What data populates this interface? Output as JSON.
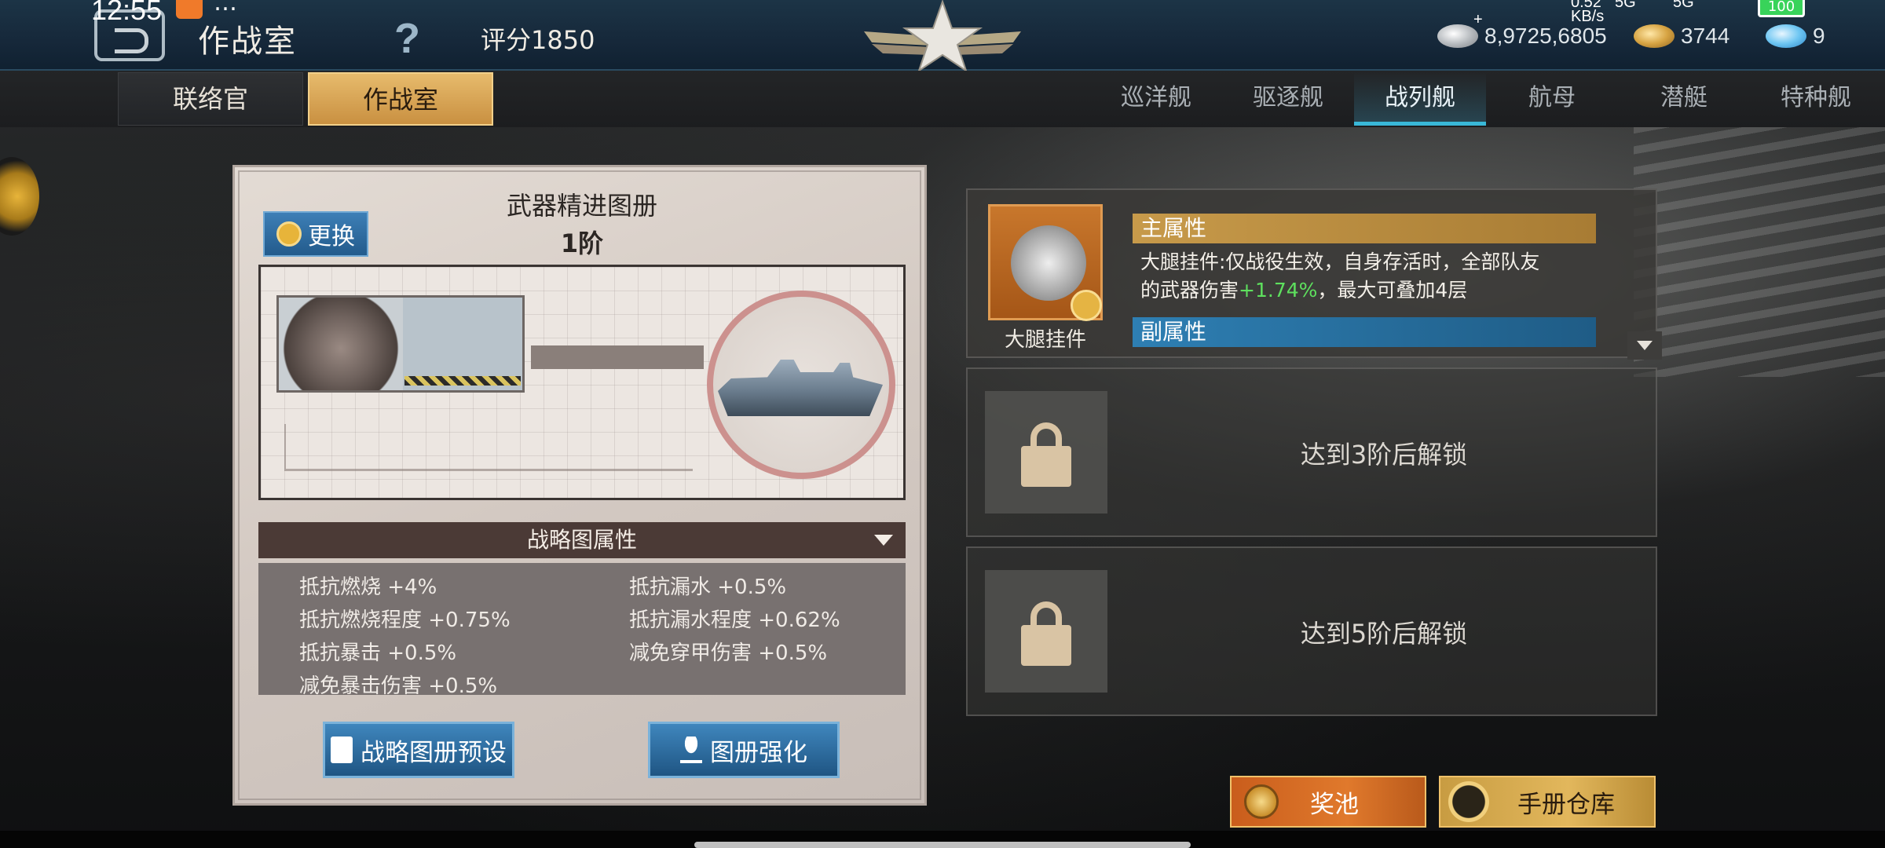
{
  "status_bar": {
    "time": "12:55",
    "more": "…",
    "net_speed_top": "0.52",
    "net_speed_unit": "KB/s",
    "signal_1": "5G",
    "signal_2": "5G",
    "battery": "100"
  },
  "header": {
    "title": "作战室",
    "help": "?",
    "score": "评分1850",
    "resources": [
      {
        "icon": "silver-coin-icon",
        "value": "8,9725,6805"
      },
      {
        "icon": "gold-coin-icon",
        "value": "3744"
      },
      {
        "icon": "cloud-gem-icon",
        "value": "9"
      }
    ],
    "silver_plus": "+"
  },
  "left_tabs": [
    {
      "label": "联络官",
      "active": false
    },
    {
      "label": "作战室",
      "active": true
    }
  ],
  "ship_tabs": [
    {
      "label": "巡洋舰",
      "active": false
    },
    {
      "label": "驱逐舰",
      "active": false
    },
    {
      "label": "战列舰",
      "active": true
    },
    {
      "label": "航母",
      "active": false
    },
    {
      "label": "潜艇",
      "active": false
    },
    {
      "label": "特种舰",
      "active": false
    }
  ],
  "album": {
    "title": "武器精进图册",
    "tier": "1阶",
    "swap_label": "更换",
    "attr_header": "战略图属性",
    "attributes": [
      "抵抗燃烧 +4%",
      "抵抗漏水 +0.5%",
      "抵抗燃烧程度 +0.75%",
      "抵抗漏水程度 +0.62%",
      "抵抗暴击 +0.5%",
      "减免穿甲伤害 +0.5%",
      "减免暴击伤害 +0.5%"
    ],
    "preset_label": "战略图册预设",
    "enhance_label": "图册强化"
  },
  "main_card": {
    "item_name": "大腿挂件",
    "main_attr_label": "主属性",
    "main_attr_text_1": "大腿挂件:仅战役生效，自身存活时，全部队友",
    "main_attr_text_2a": "的武器伤害",
    "main_attr_value": "+1.74%",
    "main_attr_text_2b": "，最大可叠加4层",
    "sub_attr_label": "副属性"
  },
  "locked_slots": [
    {
      "text": "达到3阶后解锁"
    },
    {
      "text": "达到5阶后解锁"
    }
  ],
  "bottom_buttons": {
    "pool_label": "奖池",
    "warehouse_label": "手册仓库"
  },
  "colors": {
    "active_tab": "#d9a757",
    "active_ship_tab_underline": "#39b8d8",
    "main_attr_bar": "#c79a4a",
    "sub_attr_bar": "#2e7fb3",
    "value_green": "#5ee05e",
    "primary_button": "#2f6fa3"
  }
}
